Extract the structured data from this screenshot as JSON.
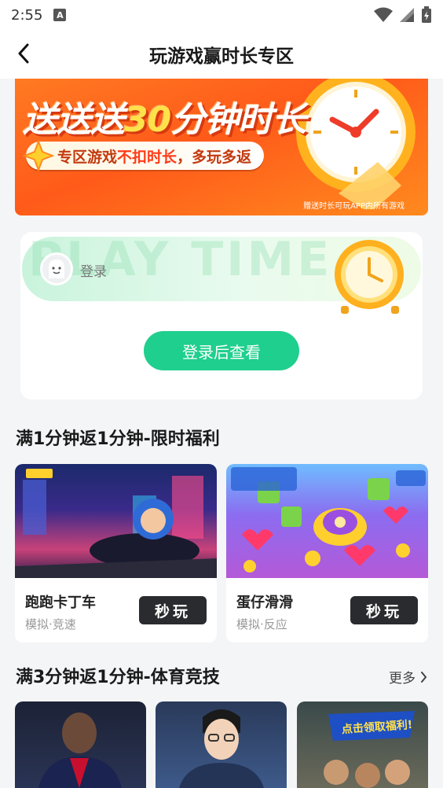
{
  "status_bar": {
    "time": "2:55",
    "notification_glyph": "A"
  },
  "nav": {
    "title": "玩游戏赢时长专区"
  },
  "banner": {
    "title_prefix": "送送送",
    "title_highlight": "30",
    "title_suffix": "分钟时长",
    "pill_prefix": "专区游戏",
    "pill_highlight": "不扣时长",
    "pill_suffix": "，多玩多返",
    "note": "赠送时长可玩APP内所有游戏"
  },
  "login_card": {
    "bg_text": "PLAY TIME",
    "login_label": "登录",
    "login_button": "登录后查看"
  },
  "section1": {
    "title": "满1分钟返1分钟-限时福利",
    "games": [
      {
        "name": "跑跑卡丁车",
        "tags": "模拟·竞速",
        "button": "秒玩"
      },
      {
        "name": "蛋仔滑滑",
        "tags": "模拟·反应",
        "button": "秒玩"
      }
    ]
  },
  "section2": {
    "title": "满3分钟返1分钟-体育竞技",
    "more": "更多",
    "thumb3_caption": "点击领取福利!"
  },
  "colors": {
    "accent_green": "#1fcf8e",
    "banner_orange": "#ff6a1f",
    "dark_button": "#2a2b2e"
  }
}
